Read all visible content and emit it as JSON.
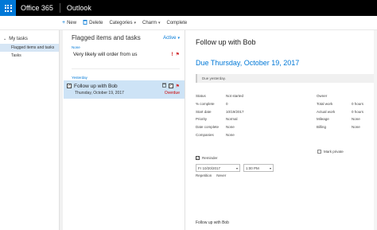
{
  "header": {
    "brand": "Office 365",
    "app": "Outlook"
  },
  "toolbar": {
    "new_label": "New",
    "delete_label": "Delete",
    "categories_label": "Categories",
    "charm_label": "Charm",
    "complete_label": "Complete"
  },
  "nav": {
    "group_label": "My tasks",
    "items": [
      {
        "label": "Flagged items and tasks"
      },
      {
        "label": "Tasks"
      }
    ]
  },
  "list": {
    "title": "Flagged items and tasks",
    "filter_label": "Active",
    "group_none": "None",
    "group_yesterday": "Yesterday",
    "task1_title": "Very likely will order from us",
    "task2_title": "Follow up with Bob",
    "task2_date": "Thursday, October 19, 2017",
    "task2_status": "Overdue"
  },
  "detail": {
    "title": "Follow up with Bob",
    "due": "Due Thursday, October 19, 2017",
    "banner": "Due yesterday.",
    "props_left": [
      {
        "label": "Status",
        "value": "Not started"
      },
      {
        "label": "% complete",
        "value": "0"
      },
      {
        "label": "Start date",
        "value": "10/19/2017"
      },
      {
        "label": "Priority",
        "value": "Normal"
      },
      {
        "label": "Date complete",
        "value": "None"
      },
      {
        "label": "Companies",
        "value": "None"
      }
    ],
    "props_right": [
      {
        "label": "Owner",
        "value": ""
      },
      {
        "label": "Total work",
        "value": "0 hours"
      },
      {
        "label": "Actual work",
        "value": "0 hours"
      },
      {
        "label": "Mileage",
        "value": "None"
      },
      {
        "label": "Billing",
        "value": "None"
      }
    ],
    "reminder_label": "Reminder",
    "reminder_date": "Fr 10/20/2017",
    "reminder_time": "1:00 PM",
    "private_label": "Mark private",
    "repetition_label": "Repetition",
    "repetition_value": "Never",
    "notes": "Follow up with Bob"
  },
  "colors": {
    "accent": "#0078d7",
    "topbar": "#000000",
    "selected": "#cde3f6",
    "overdue": "#cc0000"
  }
}
